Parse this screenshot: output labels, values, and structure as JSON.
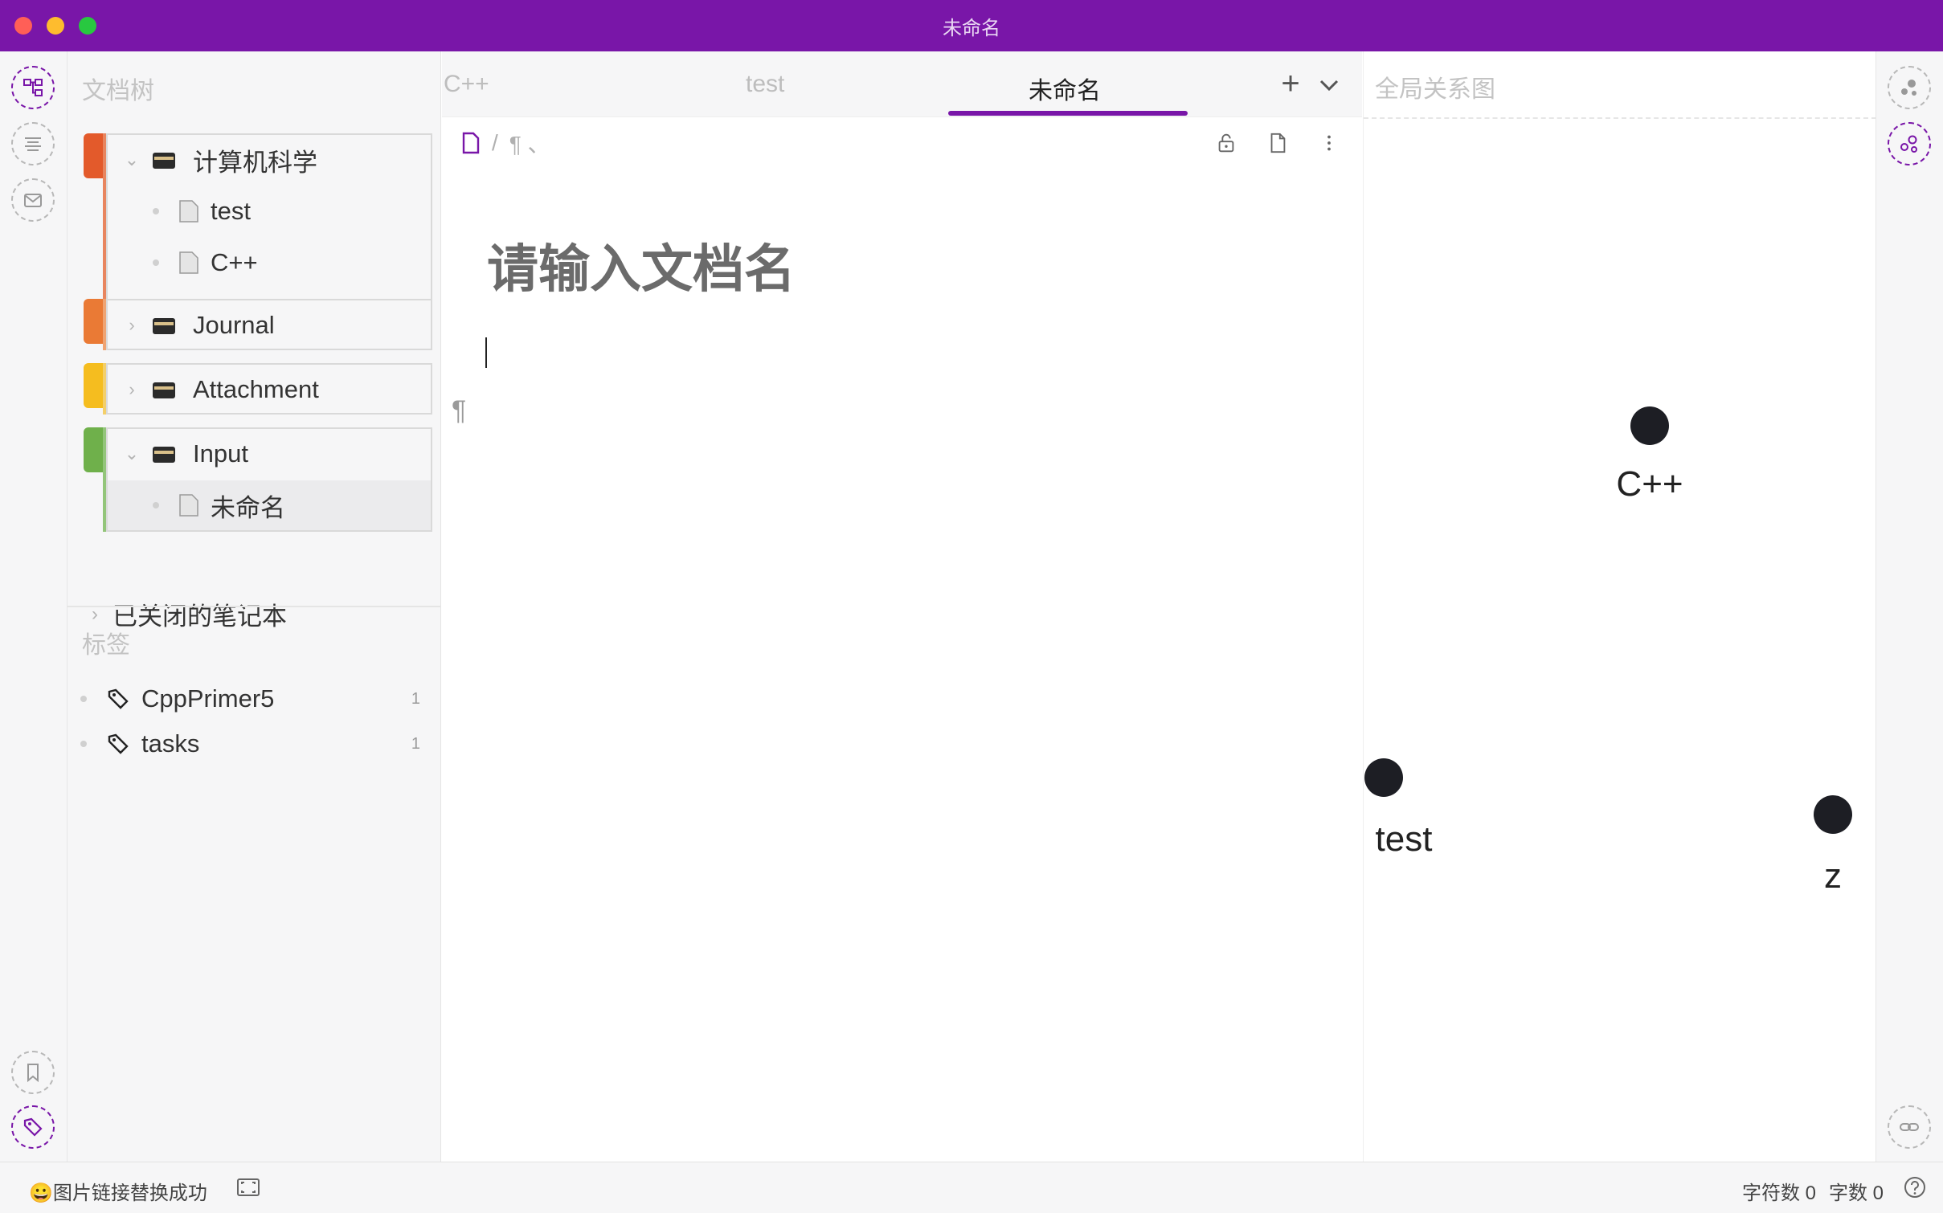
{
  "window": {
    "title": "未命名"
  },
  "panels": {
    "file_tree_title": "文档树",
    "tags_title": "标签",
    "graph_title": "全局关系图"
  },
  "notebooks": [
    {
      "name": "计算机科学",
      "color": "#e35a2b",
      "expanded": true,
      "docs": [
        {
          "name": "test"
        },
        {
          "name": "C++"
        }
      ]
    },
    {
      "name": "Journal",
      "color": "#ea7a35",
      "expanded": false,
      "docs": []
    },
    {
      "name": "Attachment",
      "color": "#f5bd1f",
      "expanded": false,
      "docs": []
    },
    {
      "name": "Input",
      "color": "#6fb04b",
      "expanded": true,
      "docs": [
        {
          "name": "未命名",
          "selected": true
        }
      ]
    }
  ],
  "closed_notebooks_label": "已关闭的笔记本",
  "tags": [
    {
      "name": "CppPrimer5",
      "count": "1"
    },
    {
      "name": "tasks",
      "count": "1"
    }
  ],
  "tabs": [
    {
      "label": "C++"
    },
    {
      "label": "test"
    },
    {
      "label": "未命名",
      "active": true
    }
  ],
  "editor": {
    "breadcrumb_sep": "/",
    "breadcrumb_item": "¶ 、",
    "title_placeholder": "请输入文档名",
    "pilcrow": "¶"
  },
  "graph_nodes": [
    {
      "label": "C++"
    },
    {
      "label": "test"
    },
    {
      "label": "z"
    }
  ],
  "status": {
    "message": "😀图片链接替换成功",
    "char_count": "字符数 0",
    "word_count": "字数 0"
  },
  "colors": {
    "accent": "#7916a8",
    "node": "#1d1e24"
  }
}
